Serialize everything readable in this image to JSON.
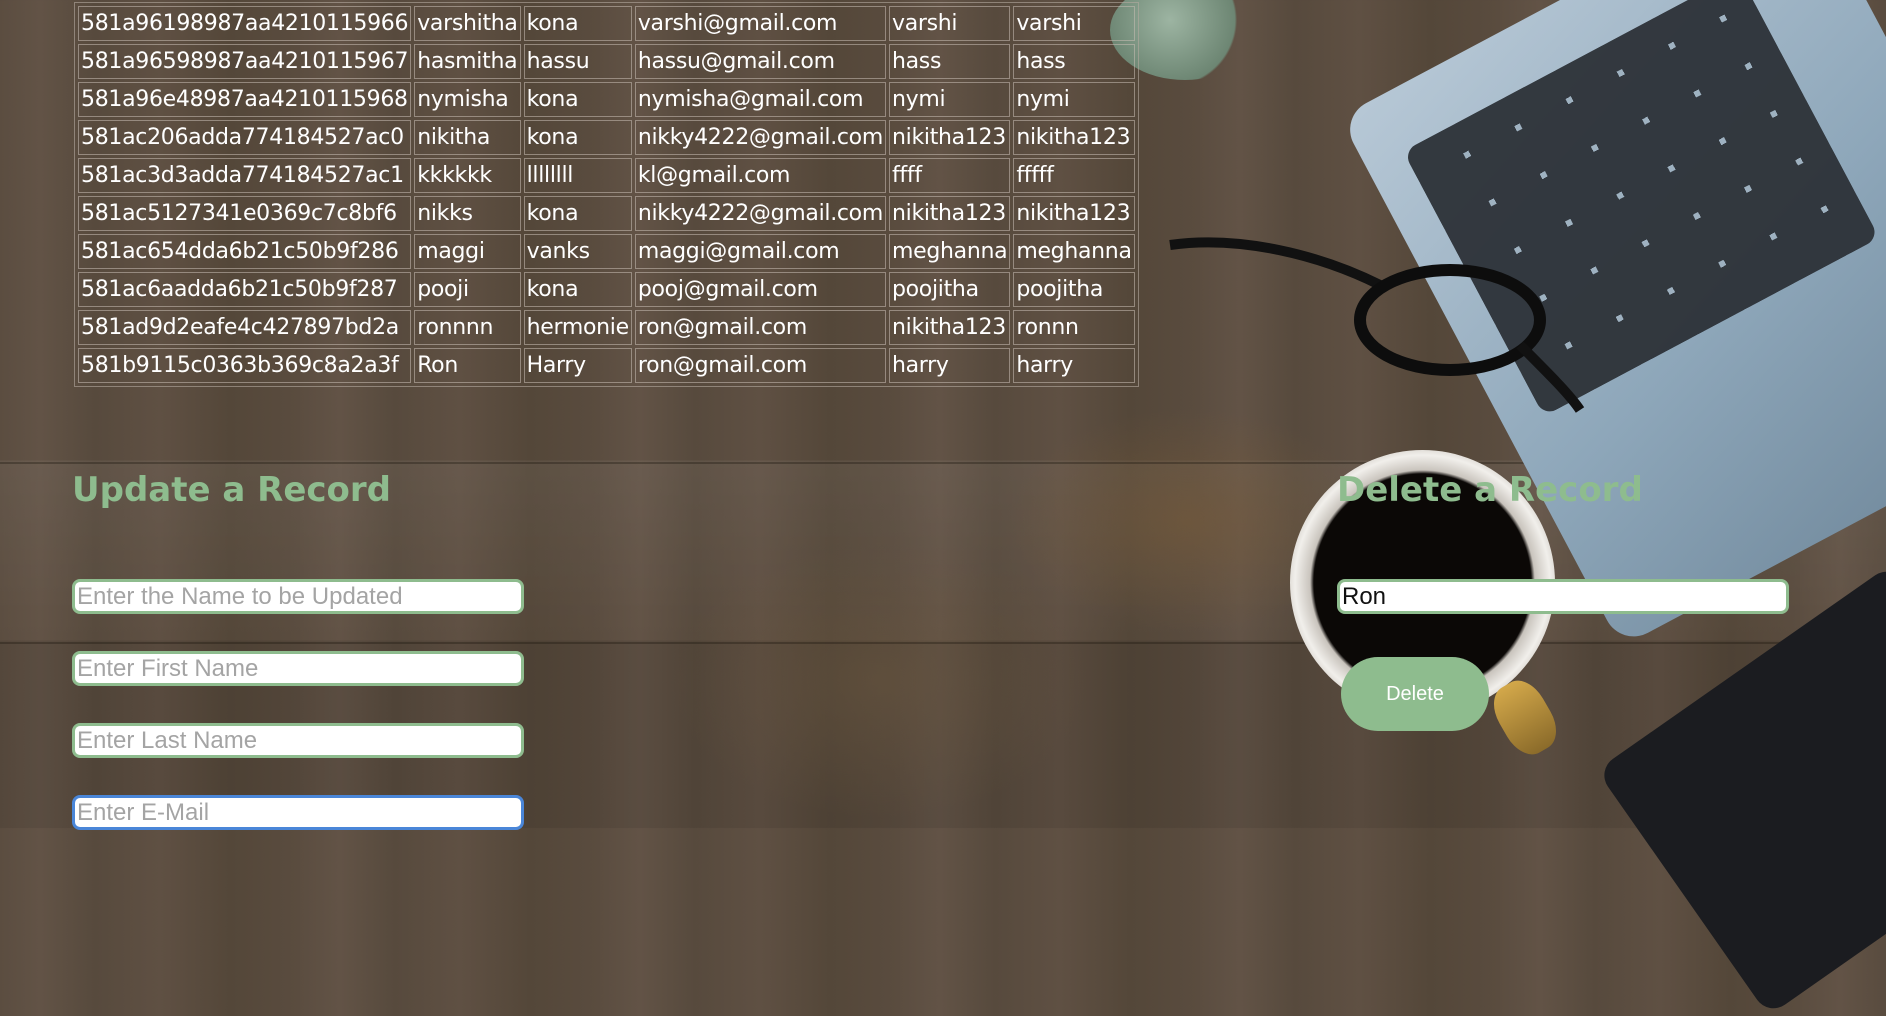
{
  "users_table": {
    "rows": [
      [
        "581a96198987aa4210115966",
        "varshitha",
        "kona",
        "varshi@gmail.com",
        "varshi",
        "varshi"
      ],
      [
        "581a96598987aa4210115967",
        "hasmitha",
        "hassu",
        "hassu@gmail.com",
        "hass",
        "hass"
      ],
      [
        "581a96e48987aa4210115968",
        "nymisha",
        "kona",
        "nymisha@gmail.com",
        "nymi",
        "nymi"
      ],
      [
        "581ac206adda774184527ac0",
        "nikitha",
        "kona",
        "nikky4222@gmail.com",
        "nikitha123",
        "nikitha123"
      ],
      [
        "581ac3d3adda774184527ac1",
        "kkkkkk",
        "llllllll",
        "kl@gmail.com",
        "ffff",
        "fffff"
      ],
      [
        "581ac5127341e0369c7c8bf6",
        "nikks",
        "kona",
        "nikky4222@gmail.com",
        "nikitha123",
        "nikitha123"
      ],
      [
        "581ac654dda6b21c50b9f286",
        "maggi",
        "vanks",
        "maggi@gmail.com",
        "meghanna",
        "meghanna"
      ],
      [
        "581ac6aadda6b21c50b9f287",
        "pooji",
        "kona",
        "pooj@gmail.com",
        "poojitha",
        "poojitha"
      ],
      [
        "581ad9d2eafe4c427897bd2a",
        "ronnnn",
        "hermonie",
        "ron@gmail.com",
        "nikitha123",
        "ronnn"
      ],
      [
        "581b9115c0363b369c8a2a3f",
        "Ron",
        "Harry",
        "ron@gmail.com",
        "harry",
        "harry"
      ]
    ]
  },
  "update": {
    "heading": "Update a Record",
    "name_placeholder": "Enter the Name to be Updated",
    "first_name_placeholder": "Enter First Name",
    "last_name_placeholder": "Enter Last Name",
    "email_placeholder": "Enter E-Mail"
  },
  "delete": {
    "heading": "Delete a Record",
    "name_value": "Ron",
    "button_label": "Delete"
  },
  "colors": {
    "accent": "#8ebc8e",
    "focus_border": "#4a86d8"
  }
}
